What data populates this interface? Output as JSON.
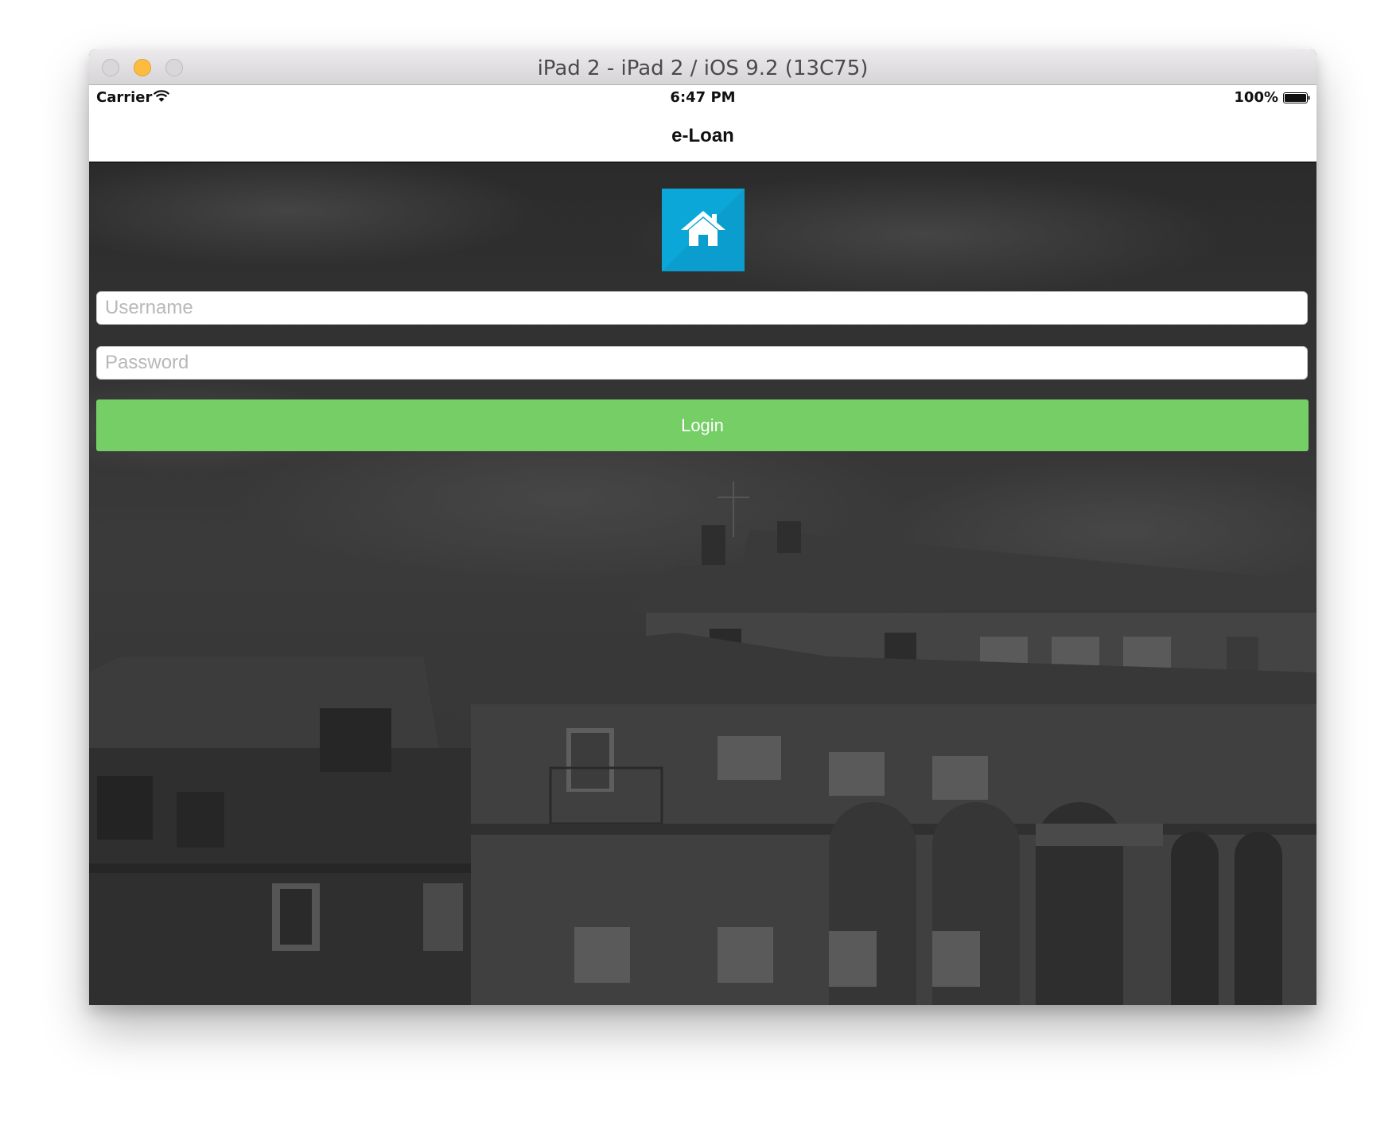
{
  "window": {
    "title": "iPad 2 - iPad 2 / iOS 9.2 (13C75)"
  },
  "status_bar": {
    "carrier": "Carrier",
    "time": "6:47 PM",
    "battery": "100%"
  },
  "nav": {
    "title": "e-Loan"
  },
  "login_form": {
    "username_placeholder": "Username",
    "password_placeholder": "Password",
    "login_label": "Login"
  },
  "colors": {
    "logo_background": "#0aa7d8",
    "login_button": "#75ce66",
    "minimize_button": "#fdbc40"
  },
  "icons": {
    "logo": "house-icon",
    "wifi": "wifi-icon",
    "battery": "battery-icon"
  }
}
